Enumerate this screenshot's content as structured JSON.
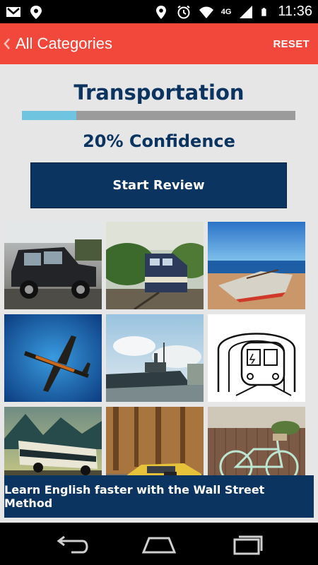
{
  "status_bar": {
    "time": "11:36",
    "network": "4G",
    "icons_left": [
      "gmail-icon",
      "maps-icon"
    ],
    "icons_right": [
      "location-icon",
      "alarm-icon",
      "wifi-icon",
      "signal-icon",
      "battery-icon"
    ]
  },
  "action_bar": {
    "back_label": "All Categories",
    "reset_label": "RESET",
    "color": "#f2483b"
  },
  "category": {
    "title": "Transportation",
    "confidence_text": "20% Confidence",
    "confidence_value": 0.2
  },
  "start_review_label": "Start Review",
  "grid": [
    {
      "name": "car-image"
    },
    {
      "name": "train-image"
    },
    {
      "name": "boat-image"
    },
    {
      "name": "airplane-image"
    },
    {
      "name": "ship-image"
    },
    {
      "name": "subway-drawing-image"
    },
    {
      "name": "bus-image"
    },
    {
      "name": "taxi-image"
    },
    {
      "name": "bicycle-image"
    }
  ],
  "banner_text": "Learn English faster with the Wall Street Method",
  "nav_bar": {
    "buttons": [
      "back-icon",
      "home-icon",
      "recent-apps-icon"
    ]
  },
  "colors": {
    "navy": "#0c3460",
    "progress_fill": "#6fc4e0",
    "progress_track": "#9b9b9b",
    "background": "#e6e6e6"
  }
}
